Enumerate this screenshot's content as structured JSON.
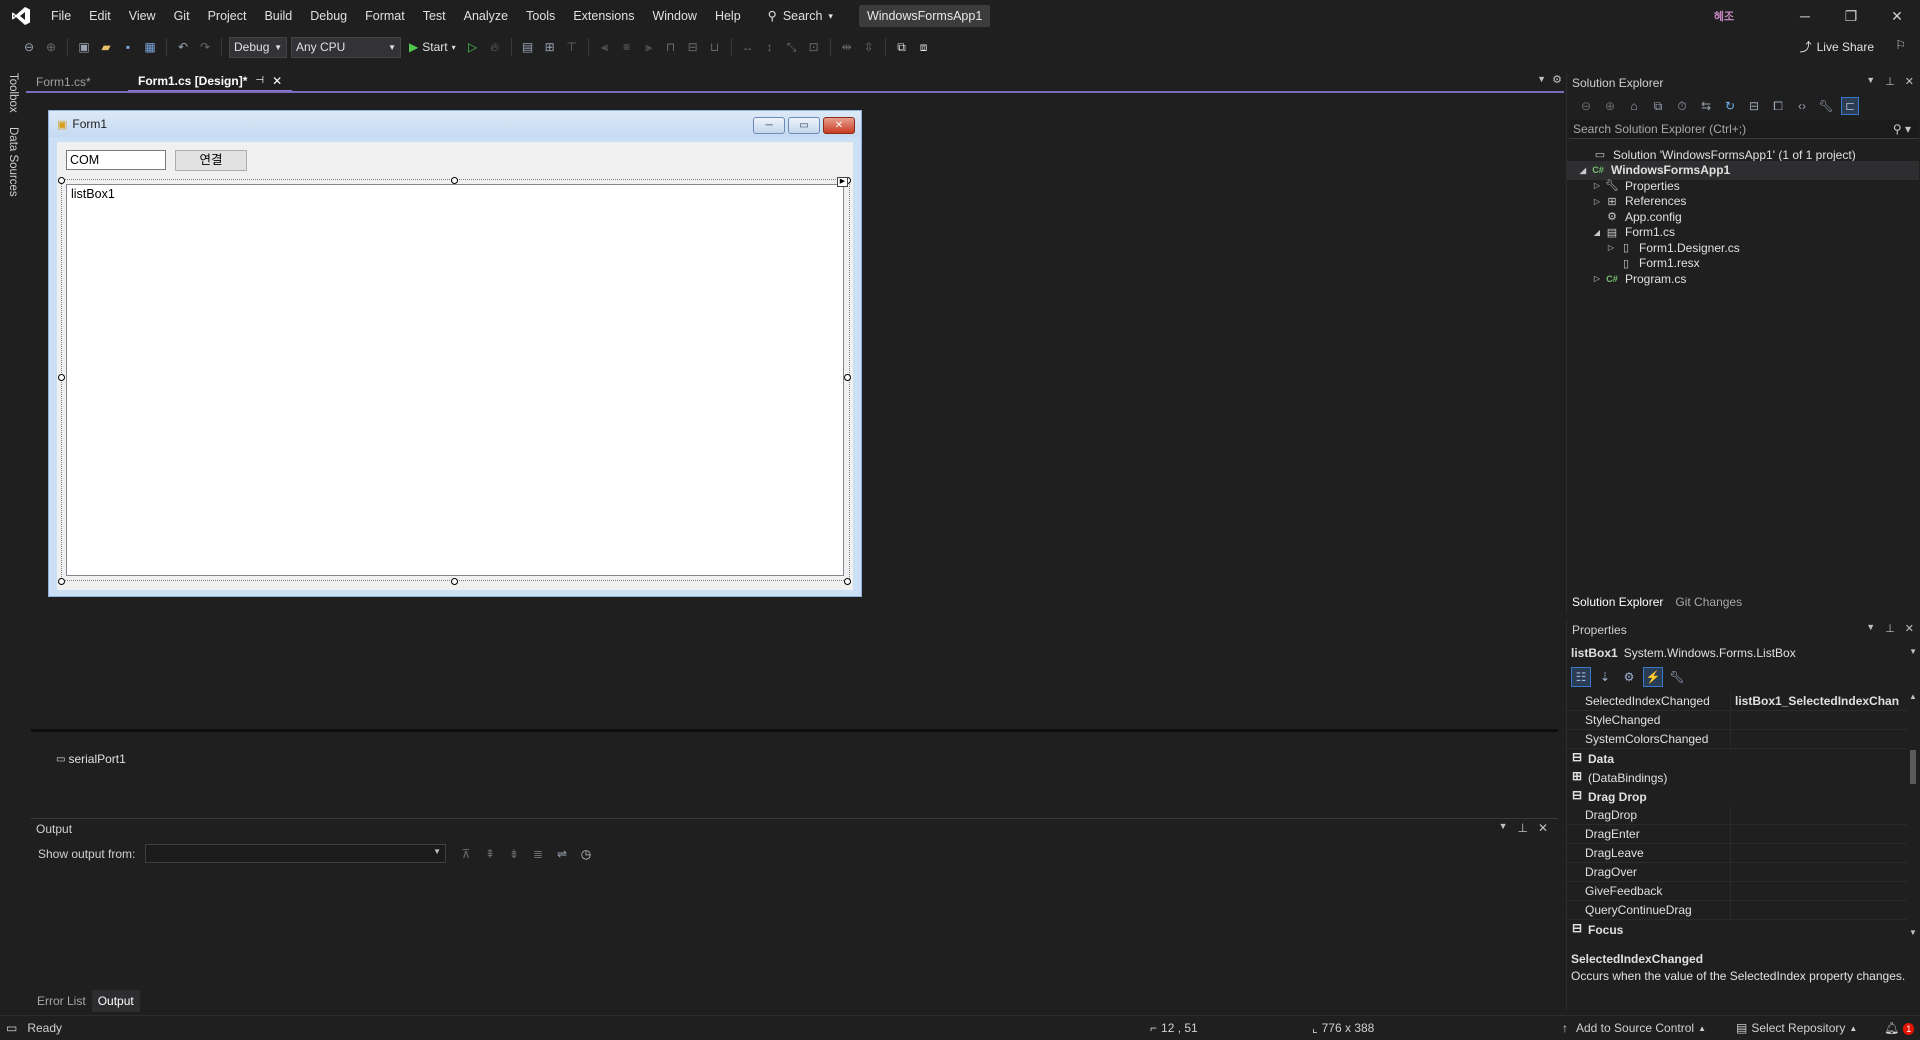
{
  "menu": {
    "items": [
      "File",
      "Edit",
      "View",
      "Git",
      "Project",
      "Build",
      "Debug",
      "Format",
      "Test",
      "Analyze",
      "Tools",
      "Extensions",
      "Window",
      "Help"
    ],
    "search_label": "Search",
    "solution_title": "WindowsFormsApp1",
    "account_badge": "혜조"
  },
  "toolbar": {
    "config": "Debug",
    "platform": "Any CPU",
    "start_label": "Start",
    "live_share_label": "Live Share"
  },
  "left_strip": {
    "toolbox_label": "Toolbox",
    "data_sources_label": "Data Sources"
  },
  "doc_tabs": [
    {
      "label": "Form1.cs*"
    },
    {
      "label": "Form1.cs [Design]*"
    }
  ],
  "form": {
    "title": "Form1",
    "com_value": "COM",
    "connect_label": "연결",
    "listbox_text": "listBox1"
  },
  "tray": {
    "component": "serialPort1"
  },
  "output": {
    "title": "Output",
    "show_from_label": "Show output from:",
    "show_from_value": ""
  },
  "bottom_tabs": [
    {
      "label": "Error List"
    },
    {
      "label": "Output"
    }
  ],
  "status": {
    "ready": "Ready",
    "position": "12 , 51",
    "size": "776 x 388",
    "source_control": "Add to Source Control",
    "repository": "Select Repository",
    "notifications": "1"
  },
  "solution_explorer": {
    "title": "Solution Explorer",
    "search_placeholder": "Search Solution Explorer (Ctrl+;)",
    "tree": [
      {
        "label": "Solution 'WindowsFormsApp1' (1 of 1 project)",
        "icon": "solution-icon",
        "arrow": ""
      },
      {
        "label": "WindowsFormsApp1",
        "icon": "csharp-project-icon",
        "arrow": "◢"
      },
      {
        "label": "Properties",
        "icon": "wrench-icon",
        "arrow": "▷"
      },
      {
        "label": "References",
        "icon": "references-icon",
        "arrow": "▷"
      },
      {
        "label": "App.config",
        "icon": "config-file-icon",
        "arrow": ""
      },
      {
        "label": "Form1.cs",
        "icon": "form-icon",
        "arrow": "◢"
      },
      {
        "label": "Form1.Designer.cs",
        "icon": "file-icon",
        "arrow": "▷"
      },
      {
        "label": "Form1.resx",
        "icon": "file-icon",
        "arrow": ""
      },
      {
        "label": "Program.cs",
        "icon": "csharp-file-icon",
        "arrow": "▷"
      }
    ],
    "tabs": [
      "Solution Explorer",
      "Git Changes"
    ]
  },
  "properties": {
    "title": "Properties",
    "object_name": "listBox1",
    "object_type": "System.Windows.Forms.ListBox",
    "rows": [
      {
        "kind": "prop",
        "name": "SelectedIndexChanged",
        "value": "listBox1_SelectedIndexChan"
      },
      {
        "kind": "prop",
        "name": "StyleChanged",
        "value": ""
      },
      {
        "kind": "prop",
        "name": "SystemColorsChanged",
        "value": ""
      },
      {
        "kind": "cat",
        "name": "Data",
        "box": "⊟"
      },
      {
        "kind": "cat2",
        "name": "(DataBindings)",
        "box": "⊞"
      },
      {
        "kind": "cat",
        "name": "Drag Drop",
        "box": "⊟"
      },
      {
        "kind": "prop",
        "name": "DragDrop",
        "value": ""
      },
      {
        "kind": "prop",
        "name": "DragEnter",
        "value": ""
      },
      {
        "kind": "prop",
        "name": "DragLeave",
        "value": ""
      },
      {
        "kind": "prop",
        "name": "DragOver",
        "value": ""
      },
      {
        "kind": "prop",
        "name": "GiveFeedback",
        "value": ""
      },
      {
        "kind": "prop",
        "name": "QueryContinueDrag",
        "value": ""
      },
      {
        "kind": "cat",
        "name": "Focus",
        "box": "⊟"
      }
    ],
    "desc_title": "SelectedIndexChanged",
    "desc_text": "Occurs when the value of the SelectedIndex property changes."
  },
  "colors": {
    "accent": "#9178d7",
    "background": "#1f1f1f",
    "form_frame": "#cce0f5"
  }
}
